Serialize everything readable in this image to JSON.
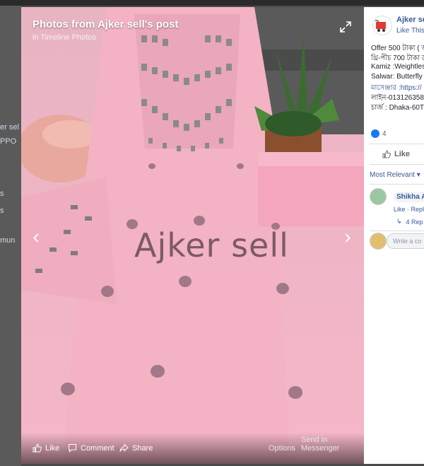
{
  "background": {
    "left_items": [
      "er sel",
      "PPO",
      "s",
      "s",
      "mun"
    ]
  },
  "viewer": {
    "title": "Photos from Ajker sell's post",
    "subtitle": "in Timeline Photos",
    "watermark": "Ajker sell",
    "actions": {
      "like": "Like",
      "comment": "Comment",
      "share": "Share",
      "options": "Options",
      "messenger": "Send in Messenger"
    }
  },
  "panel": {
    "page_name": "Ajker sel",
    "page_like": "Like This P",
    "post_lines": [
      "Offer 500 টাকা ( অ",
      "থ্রি-পীচ 700 টাকা ড",
      "Kamiz :Weightles",
      "Salwar: Butterfly",
      "মাসেঞ্জার :https://",
      "লাইন-013126358",
      "চার্জ : Dhaka-60T"
    ],
    "reaction_count": "4",
    "like_label": "Like",
    "most_relevant": "Most Relevant ▾",
    "comment_name": "Shikha Ak",
    "comment_actions": "Like · Reply",
    "replies": "4 Rep",
    "write_placeholder": "Write a co"
  }
}
